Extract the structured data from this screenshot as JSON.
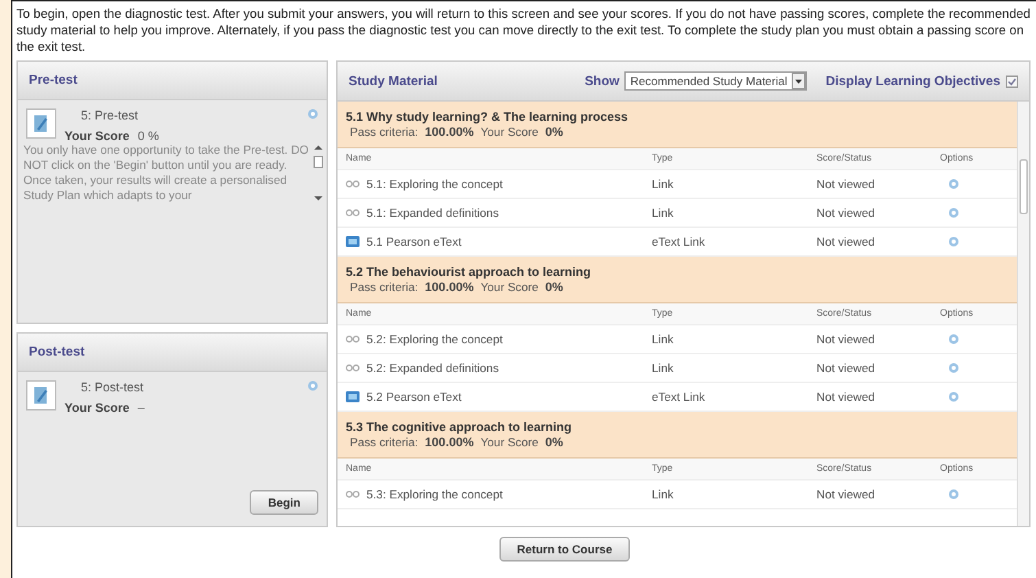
{
  "intro": "To begin, open the diagnostic test. After you submit your answers, you will return to this screen and see your scores. If you do not have passing scores, complete the recommended study material to help you improve. Alternately, if you pass the diagnostic test you can move directly to the exit test. To complete the study plan you must obtain a passing score on the exit test.",
  "pretest": {
    "title": "Pre-test",
    "item": "5: Pre-test",
    "score_label": "Your Score",
    "score": "0 %",
    "description": "You only have one opportunity to take the Pre-test. DO NOT click on the 'Begin' button until you are ready. Once taken, your results will create a personalised Study Plan which adapts to your"
  },
  "posttest": {
    "title": "Post-test",
    "item": "5: Post-test",
    "score_label": "Your Score",
    "score": "–",
    "button": "Begin"
  },
  "study": {
    "title": "Study Material",
    "show_label": "Show",
    "show_value": "Recommended Study Material",
    "objectives_label": "Display Learning Objectives",
    "objectives_checked": true,
    "sections": [
      {
        "title": "5.1 Why study learning? & The learning process",
        "pass_label": "Pass criteria:",
        "pass": "100.00%",
        "score_label": "Your Score",
        "score": "0%",
        "columns": [
          "Name",
          "Type",
          "Score/Status",
          "Options"
        ],
        "items": [
          {
            "kind": "link",
            "name": "5.1: Exploring the concept",
            "type": "Link",
            "status": "Not viewed"
          },
          {
            "kind": "link",
            "name": "5.1: Expanded definitions",
            "type": "Link",
            "status": "Not viewed"
          },
          {
            "kind": "etext",
            "name": "5.1 Pearson eText",
            "type": "eText Link",
            "status": "Not viewed"
          }
        ]
      },
      {
        "title": "5.2 The behaviourist approach to learning",
        "pass_label": "Pass criteria:",
        "pass": "100.00%",
        "score_label": "Your Score",
        "score": "0%",
        "columns": [
          "Name",
          "Type",
          "Score/Status",
          "Options"
        ],
        "items": [
          {
            "kind": "link",
            "name": "5.2: Exploring the concept",
            "type": "Link",
            "status": "Not viewed"
          },
          {
            "kind": "link",
            "name": "5.2: Expanded definitions",
            "type": "Link",
            "status": "Not viewed"
          },
          {
            "kind": "etext",
            "name": "5.2 Pearson eText",
            "type": "eText Link",
            "status": "Not viewed"
          }
        ]
      },
      {
        "title": "5.3 The cognitive approach to learning",
        "pass_label": "Pass criteria:",
        "pass": "100.00%",
        "score_label": "Your Score",
        "score": "0%",
        "columns": [
          "Name",
          "Type",
          "Score/Status",
          "Options"
        ],
        "items": [
          {
            "kind": "link",
            "name": "5.3: Exploring the concept",
            "type": "Link",
            "status": "Not viewed"
          }
        ]
      }
    ]
  },
  "footer_button": "Return to Course"
}
